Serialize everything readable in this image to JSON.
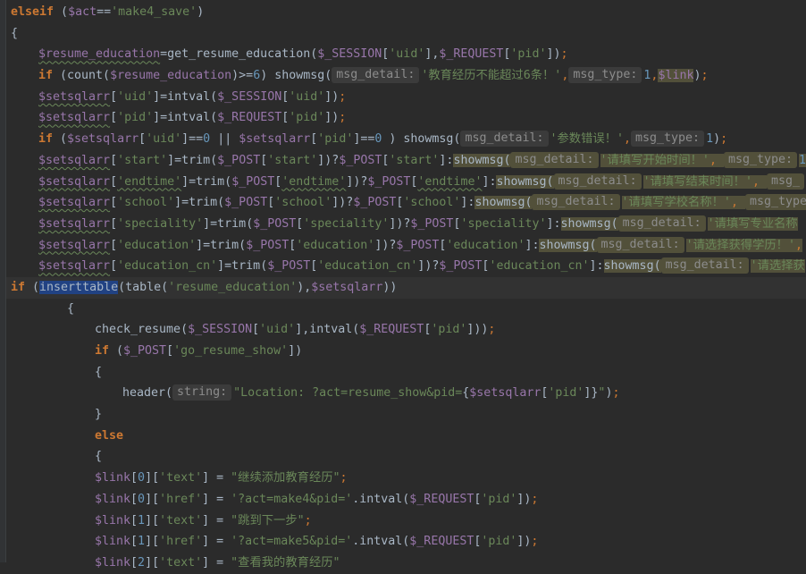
{
  "code_lines": [
    {
      "indent": 0,
      "tokens": [
        {
          "c": "kw",
          "v": "elseif"
        },
        {
          "c": "fn",
          "v": " ("
        },
        {
          "c": "va",
          "v": "$act"
        },
        {
          "c": "fn",
          "v": "=="
        },
        {
          "c": "sq",
          "v": "'make4_save'"
        },
        {
          "c": "fn",
          "v": ")"
        }
      ]
    },
    {
      "indent": 0,
      "tokens": [
        {
          "c": "fn",
          "v": "{"
        }
      ]
    },
    {
      "indent": 1,
      "tokens": [
        {
          "c": "va uw",
          "v": "$resume_education"
        },
        {
          "c": "fn",
          "v": "=get_resume_education("
        },
        {
          "c": "va",
          "v": "$_SESSION"
        },
        {
          "c": "fn",
          "v": "["
        },
        {
          "c": "sq",
          "v": "'uid'"
        },
        {
          "c": "fn",
          "v": "],"
        },
        {
          "c": "va",
          "v": "$_REQUEST"
        },
        {
          "c": "fn",
          "v": "["
        },
        {
          "c": "sq",
          "v": "'pid'"
        },
        {
          "c": "fn",
          "v": "])"
        },
        {
          "c": "pu",
          "v": ";"
        }
      ]
    },
    {
      "indent": 1,
      "tokens": [
        {
          "c": "kw",
          "v": "if"
        },
        {
          "c": "fn",
          "v": " (count("
        },
        {
          "c": "va",
          "v": "$resume_education"
        },
        {
          "c": "fn",
          "v": ")>="
        },
        {
          "c": "nu",
          "v": "6"
        },
        {
          "c": "fn",
          "v": ") showmsg("
        },
        {
          "c": "hint",
          "v": "msg_detail:"
        },
        {
          "c": "sq",
          "v": "'教育经历不能超过6条！'"
        },
        {
          "c": "pu",
          "v": ","
        },
        {
          "c": "hint",
          "v": "msg_type:"
        },
        {
          "c": "nu",
          "v": "1"
        },
        {
          "c": "pu",
          "v": ","
        },
        {
          "c": "va warn",
          "v": "$link"
        },
        {
          "c": "fn",
          "v": ")"
        },
        {
          "c": "pu",
          "v": ";"
        }
      ]
    },
    {
      "indent": 1,
      "tokens": [
        {
          "c": "va uw",
          "v": "$setsqlarr"
        },
        {
          "c": "fn",
          "v": "["
        },
        {
          "c": "sq",
          "v": "'uid'"
        },
        {
          "c": "fn",
          "v": "]=intval("
        },
        {
          "c": "va",
          "v": "$_SESSION"
        },
        {
          "c": "fn",
          "v": "["
        },
        {
          "c": "sq",
          "v": "'uid'"
        },
        {
          "c": "fn",
          "v": "])"
        },
        {
          "c": "pu",
          "v": ";"
        }
      ]
    },
    {
      "indent": 1,
      "tokens": [
        {
          "c": "va uw",
          "v": "$setsqlarr"
        },
        {
          "c": "fn",
          "v": "["
        },
        {
          "c": "sq",
          "v": "'pid'"
        },
        {
          "c": "fn",
          "v": "]=intval("
        },
        {
          "c": "va",
          "v": "$_REQUEST"
        },
        {
          "c": "fn",
          "v": "["
        },
        {
          "c": "sq",
          "v": "'pid'"
        },
        {
          "c": "fn",
          "v": "])"
        },
        {
          "c": "pu",
          "v": ";"
        }
      ]
    },
    {
      "indent": 1,
      "tokens": [
        {
          "c": "kw",
          "v": "if"
        },
        {
          "c": "fn",
          "v": " ("
        },
        {
          "c": "va",
          "v": "$setsqlarr"
        },
        {
          "c": "fn",
          "v": "["
        },
        {
          "c": "sq",
          "v": "'uid'"
        },
        {
          "c": "fn",
          "v": "]=="
        },
        {
          "c": "nu",
          "v": "0"
        },
        {
          "c": "fn",
          "v": " || "
        },
        {
          "c": "va",
          "v": "$setsqlarr"
        },
        {
          "c": "fn",
          "v": "["
        },
        {
          "c": "sq",
          "v": "'pid'"
        },
        {
          "c": "fn",
          "v": "]=="
        },
        {
          "c": "nu",
          "v": "0"
        },
        {
          "c": "fn",
          "v": " ) showmsg("
        },
        {
          "c": "hint",
          "v": "msg_detail:"
        },
        {
          "c": "sq",
          "v": "'参数错误！'"
        },
        {
          "c": "pu",
          "v": ","
        },
        {
          "c": "hint",
          "v": "msg_type:"
        },
        {
          "c": "nu",
          "v": "1"
        },
        {
          "c": "fn",
          "v": ")"
        },
        {
          "c": "pu",
          "v": ";"
        }
      ]
    },
    {
      "indent": 1,
      "tokens": [
        {
          "c": "va uw",
          "v": "$setsqlarr"
        },
        {
          "c": "fn",
          "v": "["
        },
        {
          "c": "sq",
          "v": "'start'"
        },
        {
          "c": "fn",
          "v": "]=trim("
        },
        {
          "c": "va",
          "v": "$_POST"
        },
        {
          "c": "fn",
          "v": "["
        },
        {
          "c": "sq",
          "v": "'start'"
        },
        {
          "c": "fn",
          "v": "])?"
        },
        {
          "c": "va",
          "v": "$_POST"
        },
        {
          "c": "fn",
          "v": "["
        },
        {
          "c": "sq",
          "v": "'start'"
        },
        {
          "c": "fn",
          "v": "]:"
        },
        {
          "c": "fn warn",
          "v": "showmsg("
        },
        {
          "c": "hint warn",
          "v": "msg_detail:"
        },
        {
          "c": "sq warn",
          "v": "'请填写开始时间！'"
        },
        {
          "c": "pu warn",
          "v": ", "
        },
        {
          "c": "hint warn",
          "v": "msg_type:"
        },
        {
          "c": "nu warn",
          "v": "1"
        }
      ]
    },
    {
      "indent": 1,
      "tokens": [
        {
          "c": "va uw",
          "v": "$setsqlarr"
        },
        {
          "c": "fn",
          "v": "["
        },
        {
          "c": "sq uw",
          "v": "'endtime'"
        },
        {
          "c": "fn",
          "v": "]=trim("
        },
        {
          "c": "va",
          "v": "$_POST"
        },
        {
          "c": "fn",
          "v": "["
        },
        {
          "c": "sq uw",
          "v": "'endtime'"
        },
        {
          "c": "fn",
          "v": "])?"
        },
        {
          "c": "va",
          "v": "$_POST"
        },
        {
          "c": "fn",
          "v": "["
        },
        {
          "c": "sq uw",
          "v": "'endtime'"
        },
        {
          "c": "fn",
          "v": "]:"
        },
        {
          "c": "fn warn",
          "v": "showmsg("
        },
        {
          "c": "hint warn",
          "v": "msg_detail:"
        },
        {
          "c": "sq warn",
          "v": "'请填写结束时间！'"
        },
        {
          "c": "pu warn",
          "v": ", "
        },
        {
          "c": "hint warn",
          "v": "msg_"
        }
      ]
    },
    {
      "indent": 1,
      "tokens": [
        {
          "c": "va uw",
          "v": "$setsqlarr"
        },
        {
          "c": "fn",
          "v": "["
        },
        {
          "c": "sq",
          "v": "'school'"
        },
        {
          "c": "fn",
          "v": "]=trim("
        },
        {
          "c": "va",
          "v": "$_POST"
        },
        {
          "c": "fn",
          "v": "["
        },
        {
          "c": "sq",
          "v": "'school'"
        },
        {
          "c": "fn",
          "v": "])?"
        },
        {
          "c": "va",
          "v": "$_POST"
        },
        {
          "c": "fn",
          "v": "["
        },
        {
          "c": "sq",
          "v": "'school'"
        },
        {
          "c": "fn",
          "v": "]:"
        },
        {
          "c": "fn warn",
          "v": "showmsg("
        },
        {
          "c": "hint warn",
          "v": "msg_detail:"
        },
        {
          "c": "sq warn",
          "v": "'请填写学校名称！'"
        },
        {
          "c": "pu warn",
          "v": ", "
        },
        {
          "c": "hint warn",
          "v": "msg_type"
        }
      ]
    },
    {
      "indent": 1,
      "tokens": [
        {
          "c": "va uw",
          "v": "$setsqlarr"
        },
        {
          "c": "fn",
          "v": "["
        },
        {
          "c": "sq",
          "v": "'speciality'"
        },
        {
          "c": "fn",
          "v": "]=trim("
        },
        {
          "c": "va",
          "v": "$_POST"
        },
        {
          "c": "fn",
          "v": "["
        },
        {
          "c": "sq",
          "v": "'speciality'"
        },
        {
          "c": "fn",
          "v": "])?"
        },
        {
          "c": "va",
          "v": "$_POST"
        },
        {
          "c": "fn",
          "v": "["
        },
        {
          "c": "sq",
          "v": "'speciality'"
        },
        {
          "c": "fn",
          "v": "]:"
        },
        {
          "c": "fn warn",
          "v": "showmsg("
        },
        {
          "c": "hint warn",
          "v": "msg_detail:"
        },
        {
          "c": "sq warn",
          "v": "'请填写专业名称"
        }
      ]
    },
    {
      "indent": 1,
      "tokens": [
        {
          "c": "va uw",
          "v": "$setsqlarr"
        },
        {
          "c": "fn",
          "v": "["
        },
        {
          "c": "sq",
          "v": "'education'"
        },
        {
          "c": "fn",
          "v": "]=trim("
        },
        {
          "c": "va",
          "v": "$_POST"
        },
        {
          "c": "fn",
          "v": "["
        },
        {
          "c": "sq",
          "v": "'education'"
        },
        {
          "c": "fn",
          "v": "])?"
        },
        {
          "c": "va",
          "v": "$_POST"
        },
        {
          "c": "fn",
          "v": "["
        },
        {
          "c": "sq",
          "v": "'education'"
        },
        {
          "c": "fn",
          "v": "]:"
        },
        {
          "c": "fn warn",
          "v": "showmsg("
        },
        {
          "c": "hint warn",
          "v": "msg_detail:"
        },
        {
          "c": "sq warn",
          "v": "'请选择获得学历！'"
        },
        {
          "c": "pu warn",
          "v": ","
        }
      ]
    },
    {
      "indent": 1,
      "tokens": [
        {
          "c": "va uw",
          "v": "$setsqlarr"
        },
        {
          "c": "fn",
          "v": "["
        },
        {
          "c": "sq",
          "v": "'education_cn'"
        },
        {
          "c": "fn",
          "v": "]=trim("
        },
        {
          "c": "va",
          "v": "$_POST"
        },
        {
          "c": "fn",
          "v": "["
        },
        {
          "c": "sq",
          "v": "'education_cn'"
        },
        {
          "c": "fn",
          "v": "])?"
        },
        {
          "c": "va",
          "v": "$_POST"
        },
        {
          "c": "fn",
          "v": "["
        },
        {
          "c": "sq",
          "v": "'education_cn'"
        },
        {
          "c": "fn",
          "v": "]:"
        },
        {
          "c": "fn warn",
          "v": "showmsg("
        },
        {
          "c": "hint warn",
          "v": "msg_detail:"
        },
        {
          "c": "sq warn",
          "v": "'请选择获"
        }
      ]
    },
    {
      "indent": 2,
      "current": true,
      "tokens": [
        {
          "c": "kw",
          "v": "if"
        },
        {
          "c": "fn",
          "v": " ("
        },
        {
          "c": "fn sel",
          "v": "inserttable"
        },
        {
          "c": "fn",
          "v": "(table("
        },
        {
          "c": "sq",
          "v": "'resume_education'"
        },
        {
          "c": "fn",
          "v": "),"
        },
        {
          "c": "va",
          "v": "$setsqlarr"
        },
        {
          "c": "fn",
          "v": "))"
        }
      ]
    },
    {
      "indent": 2,
      "tokens": [
        {
          "c": "fn",
          "v": "{"
        }
      ]
    },
    {
      "indent": 3,
      "tokens": [
        {
          "c": "fn",
          "v": "check_resume("
        },
        {
          "c": "va",
          "v": "$_SESSION"
        },
        {
          "c": "fn",
          "v": "["
        },
        {
          "c": "sq",
          "v": "'uid'"
        },
        {
          "c": "fn",
          "v": "],intval("
        },
        {
          "c": "va",
          "v": "$_REQUEST"
        },
        {
          "c": "fn",
          "v": "["
        },
        {
          "c": "sq",
          "v": "'pid'"
        },
        {
          "c": "fn",
          "v": "]))"
        },
        {
          "c": "pu",
          "v": ";"
        }
      ]
    },
    {
      "indent": 3,
      "tokens": [
        {
          "c": "kw",
          "v": "if"
        },
        {
          "c": "fn",
          "v": " ("
        },
        {
          "c": "va",
          "v": "$_POST"
        },
        {
          "c": "fn",
          "v": "["
        },
        {
          "c": "sq",
          "v": "'go_resume_show'"
        },
        {
          "c": "fn",
          "v": "])"
        }
      ]
    },
    {
      "indent": 3,
      "tokens": [
        {
          "c": "fn",
          "v": "{"
        }
      ]
    },
    {
      "indent": 4,
      "tokens": [
        {
          "c": "fn",
          "v": "header("
        },
        {
          "c": "hint",
          "v": "string:"
        },
        {
          "c": "sq",
          "v": "\"Location: ?act=resume_show&pid="
        },
        {
          "c": "fn",
          "v": "{"
        },
        {
          "c": "va",
          "v": "$setsqlarr"
        },
        {
          "c": "fn",
          "v": "["
        },
        {
          "c": "sq",
          "v": "'pid'"
        },
        {
          "c": "fn",
          "v": "]}"
        },
        {
          "c": "sq",
          "v": "\""
        },
        {
          "c": "fn",
          "v": ")"
        },
        {
          "c": "pu",
          "v": ";"
        }
      ]
    },
    {
      "indent": 3,
      "tokens": [
        {
          "c": "fn",
          "v": "}"
        }
      ]
    },
    {
      "indent": 3,
      "tokens": [
        {
          "c": "kw",
          "v": "else"
        }
      ]
    },
    {
      "indent": 3,
      "tokens": [
        {
          "c": "fn",
          "v": "{"
        }
      ]
    },
    {
      "indent": 3,
      "tokens": [
        {
          "c": "va",
          "v": "$link"
        },
        {
          "c": "fn",
          "v": "["
        },
        {
          "c": "nu",
          "v": "0"
        },
        {
          "c": "fn",
          "v": "]["
        },
        {
          "c": "sq",
          "v": "'text'"
        },
        {
          "c": "fn",
          "v": "] = "
        },
        {
          "c": "sq",
          "v": "\"继续添加教育经历\""
        },
        {
          "c": "pu",
          "v": ";"
        }
      ]
    },
    {
      "indent": 3,
      "tokens": [
        {
          "c": "va",
          "v": "$link"
        },
        {
          "c": "fn",
          "v": "["
        },
        {
          "c": "nu",
          "v": "0"
        },
        {
          "c": "fn",
          "v": "]["
        },
        {
          "c": "sq",
          "v": "'href'"
        },
        {
          "c": "fn",
          "v": "] = "
        },
        {
          "c": "sq",
          "v": "'?act=make4&pid='"
        },
        {
          "c": "fn",
          "v": ".intval("
        },
        {
          "c": "va",
          "v": "$_REQUEST"
        },
        {
          "c": "fn",
          "v": "["
        },
        {
          "c": "sq",
          "v": "'pid'"
        },
        {
          "c": "fn",
          "v": "])"
        },
        {
          "c": "pu",
          "v": ";"
        }
      ]
    },
    {
      "indent": 3,
      "tokens": [
        {
          "c": "va",
          "v": "$link"
        },
        {
          "c": "fn",
          "v": "["
        },
        {
          "c": "nu",
          "v": "1"
        },
        {
          "c": "fn",
          "v": "]["
        },
        {
          "c": "sq",
          "v": "'text'"
        },
        {
          "c": "fn",
          "v": "] = "
        },
        {
          "c": "sq",
          "v": "\"跳到下一步\""
        },
        {
          "c": "pu",
          "v": ";"
        }
      ]
    },
    {
      "indent": 3,
      "tokens": [
        {
          "c": "va",
          "v": "$link"
        },
        {
          "c": "fn",
          "v": "["
        },
        {
          "c": "nu",
          "v": "1"
        },
        {
          "c": "fn",
          "v": "]["
        },
        {
          "c": "sq",
          "v": "'href'"
        },
        {
          "c": "fn",
          "v": "] = "
        },
        {
          "c": "sq",
          "v": "'?act=make5&pid='"
        },
        {
          "c": "fn",
          "v": ".intval("
        },
        {
          "c": "va",
          "v": "$_REQUEST"
        },
        {
          "c": "fn",
          "v": "["
        },
        {
          "c": "sq",
          "v": "'pid'"
        },
        {
          "c": "fn",
          "v": "])"
        },
        {
          "c": "pu",
          "v": ";"
        }
      ]
    },
    {
      "indent": 3,
      "tokens": [
        {
          "c": "va",
          "v": "$link"
        },
        {
          "c": "fn",
          "v": "["
        },
        {
          "c": "nu",
          "v": "2"
        },
        {
          "c": "fn",
          "v": "]["
        },
        {
          "c": "sq",
          "v": "'text'"
        },
        {
          "c": "fn",
          "v": "] = "
        },
        {
          "c": "sq",
          "v": "\"查看我的教育经历\""
        }
      ]
    }
  ]
}
